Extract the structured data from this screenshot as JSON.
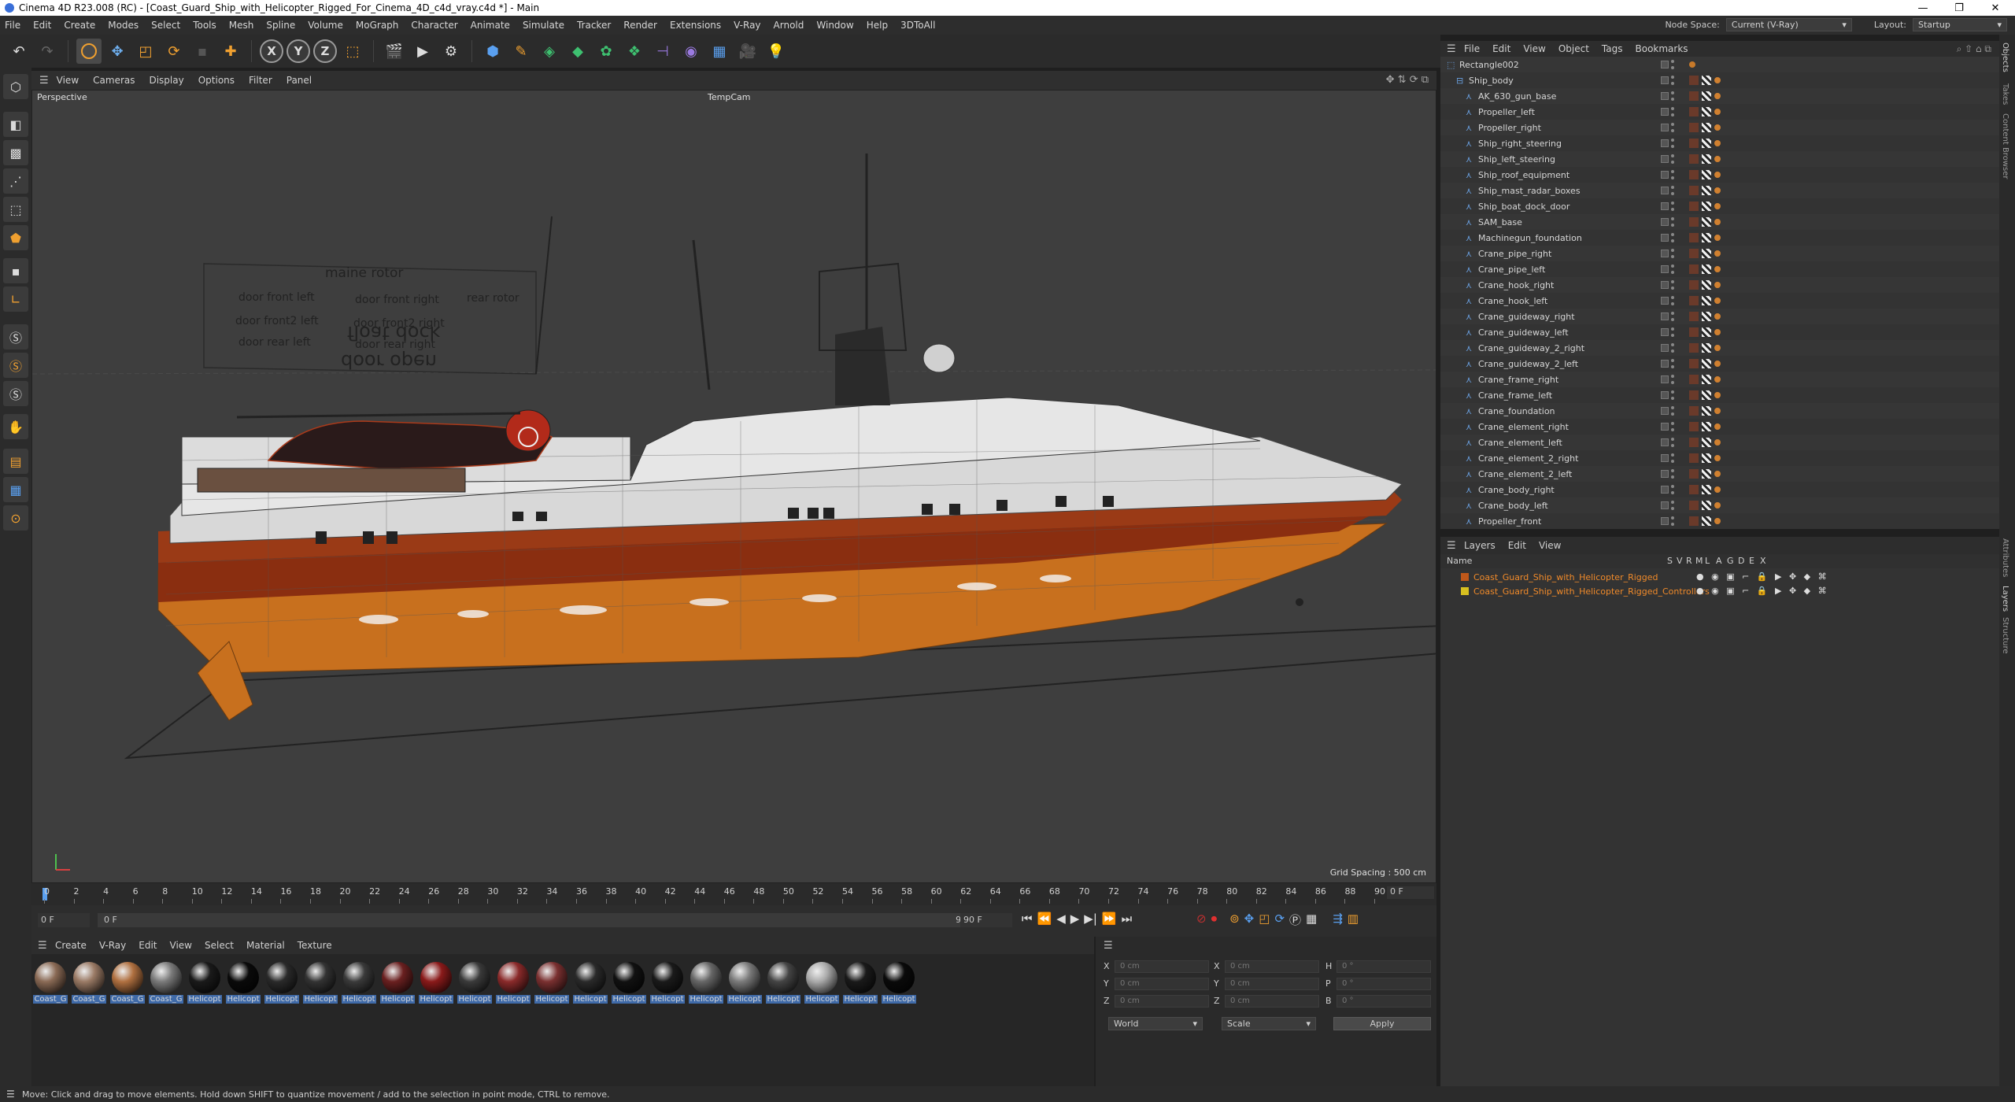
{
  "window": {
    "title": "Cinema 4D R23.008 (RC) - [Coast_Guard_Ship_with_Helicopter_Rigged_For_Cinema_4D_c4d_vray.c4d *] - Main",
    "controls": [
      "—",
      "❐",
      "✕"
    ]
  },
  "menu": {
    "items": [
      "File",
      "Edit",
      "Create",
      "Modes",
      "Select",
      "Tools",
      "Mesh",
      "Spline",
      "Volume",
      "MoGraph",
      "Character",
      "Animate",
      "Simulate",
      "Tracker",
      "Render",
      "Extensions",
      "V-Ray",
      "Arnold",
      "Window",
      "Help",
      "3DToAll"
    ],
    "node_space_label": "Node Space:",
    "node_space_value": "Current (V-Ray)",
    "layout_label": "Layout:",
    "layout_value": "Startup"
  },
  "viewport": {
    "menu": [
      "View",
      "Cameras",
      "Display",
      "Options",
      "Filter",
      "Panel"
    ],
    "name": "Perspective",
    "camera": "TempCam",
    "grid_spacing": "Grid Spacing : 500 cm",
    "labels": {
      "main_rotor": "maine rotor",
      "door_front_left": "door front left",
      "door_front_right": "door front right",
      "rear_rotor": "rear rotor",
      "door_front2_left": "door front2 left",
      "door_front2_right": "door front2 right",
      "door_rear_left": "door rear left",
      "door_rear_right": "door rear right",
      "float_dock": "float dock",
      "door_open": "door open"
    }
  },
  "timeline": {
    "ticks": [
      "0",
      "2",
      "4",
      "6",
      "8",
      "10",
      "12",
      "14",
      "16",
      "18",
      "20",
      "22",
      "24",
      "26",
      "28",
      "30",
      "32",
      "34",
      "36",
      "38",
      "40",
      "42",
      "44",
      "46",
      "48",
      "50",
      "52",
      "54",
      "56",
      "58",
      "60",
      "62",
      "64",
      "66",
      "68",
      "70",
      "72",
      "74",
      "76",
      "78",
      "80",
      "82",
      "84",
      "86",
      "88",
      "90"
    ],
    "current_frame": "0 F",
    "start_frame": "0 F",
    "min_frame": "0 F",
    "max_frame": "90 F",
    "end_frame": "90 F"
  },
  "material_manager": {
    "menu": [
      "Create",
      "V-Ray",
      "Edit",
      "View",
      "Select",
      "Material",
      "Texture"
    ],
    "materials": [
      {
        "label": "Coast_G",
        "color": "#8a6a55"
      },
      {
        "label": "Coast_G",
        "color": "#9a7a65"
      },
      {
        "label": "Coast_G",
        "color": "#b07040"
      },
      {
        "label": "Coast_G",
        "color": "#7a7a7a"
      },
      {
        "label": "Helicopt",
        "color": "#1a1a1a"
      },
      {
        "label": "Helicopt",
        "color": "#0a0a0a"
      },
      {
        "label": "Helicopt",
        "color": "#2a2a2a"
      },
      {
        "label": "Helicopt",
        "color": "#333333"
      },
      {
        "label": "Helicopt",
        "color": "#3a3a3a"
      },
      {
        "label": "Helicopt",
        "color": "#6a2020"
      },
      {
        "label": "Helicopt",
        "color": "#8a1a1a"
      },
      {
        "label": "Helicopt",
        "color": "#3a3a3a"
      },
      {
        "label": "Helicopt",
        "color": "#8a2a2a"
      },
      {
        "label": "Helicopt",
        "color": "#7a3030"
      },
      {
        "label": "Helicopt",
        "color": "#2a2a2a"
      },
      {
        "label": "Helicopt",
        "color": "#111111"
      },
      {
        "label": "Helicopt",
        "color": "#1a1a1a"
      },
      {
        "label": "Helicopt",
        "color": "#666666"
      },
      {
        "label": "Helicopt",
        "color": "#7a7a7a"
      },
      {
        "label": "Helicopt",
        "color": "#444444"
      },
      {
        "label": "Helicopt",
        "color": "#aaaaaa"
      },
      {
        "label": "Helicopt",
        "color": "#1a1a1a"
      },
      {
        "label": "Helicopt",
        "color": "#0a0a0a"
      }
    ]
  },
  "coordinates": {
    "rows": [
      {
        "a": "X",
        "av": "0 cm",
        "b": "X",
        "bv": "0 cm",
        "c": "H",
        "cv": "0 °"
      },
      {
        "a": "Y",
        "av": "0 cm",
        "b": "Y",
        "bv": "0 cm",
        "c": "P",
        "cv": "0 °"
      },
      {
        "a": "Z",
        "av": "0 cm",
        "b": "Z",
        "bv": "0 cm",
        "c": "B",
        "cv": "0 °"
      }
    ],
    "mode": "World",
    "scale": "Scale",
    "apply": "Apply"
  },
  "object_manager": {
    "menu": [
      "File",
      "Edit",
      "View",
      "Object",
      "Tags",
      "Bookmarks"
    ],
    "objects": [
      {
        "name": "Rectangle002",
        "level": 0
      },
      {
        "name": "Ship_body",
        "level": 1
      },
      {
        "name": "AK_630_gun_base",
        "level": 2
      },
      {
        "name": "Propeller_left",
        "level": 2
      },
      {
        "name": "Propeller_right",
        "level": 2
      },
      {
        "name": "Ship_right_steering",
        "level": 2
      },
      {
        "name": "Ship_left_steering",
        "level": 2
      },
      {
        "name": "Ship_roof_equipment",
        "level": 2
      },
      {
        "name": "Ship_mast_radar_boxes",
        "level": 2
      },
      {
        "name": "Ship_boat_dock_door",
        "level": 2
      },
      {
        "name": "SAM_base",
        "level": 2
      },
      {
        "name": "Machinegun_foundation",
        "level": 2
      },
      {
        "name": "Crane_pipe_right",
        "level": 2
      },
      {
        "name": "Crane_pipe_left",
        "level": 2
      },
      {
        "name": "Crane_hook_right",
        "level": 2
      },
      {
        "name": "Crane_hook_left",
        "level": 2
      },
      {
        "name": "Crane_guideway_right",
        "level": 2
      },
      {
        "name": "Crane_guideway_left",
        "level": 2
      },
      {
        "name": "Crane_guideway_2_right",
        "level": 2
      },
      {
        "name": "Crane_guideway_2_left",
        "level": 2
      },
      {
        "name": "Crane_frame_right",
        "level": 2
      },
      {
        "name": "Crane_frame_left",
        "level": 2
      },
      {
        "name": "Crane_foundation",
        "level": 2
      },
      {
        "name": "Crane_element_right",
        "level": 2
      },
      {
        "name": "Crane_element_left",
        "level": 2
      },
      {
        "name": "Crane_element_2_right",
        "level": 2
      },
      {
        "name": "Crane_element_2_left",
        "level": 2
      },
      {
        "name": "Crane_body_right",
        "level": 2
      },
      {
        "name": "Crane_body_left",
        "level": 2
      },
      {
        "name": "Propeller_front",
        "level": 2
      }
    ]
  },
  "layers": {
    "menu": [
      "Layers",
      "Edit",
      "View"
    ],
    "columns": [
      "Name",
      "S",
      "V",
      "R",
      "M",
      "L",
      "A",
      "G",
      "D",
      "E",
      "X"
    ],
    "items": [
      {
        "name": "Coast_Guard_Ship_with_Helicopter_Rigged",
        "color": "#c0581a"
      },
      {
        "name": "Coast_Guard_Ship_with_Helicopter_Rigged_Controllers",
        "color": "#d8c020"
      }
    ]
  },
  "right_tabs": [
    "Objects",
    "Takes",
    "Content Browser",
    "Attributes",
    "Layers",
    "Structure"
  ],
  "status": "Move: Click and drag to move elements. Hold down SHIFT to quantize movement / add to the selection in point mode, CTRL to remove."
}
